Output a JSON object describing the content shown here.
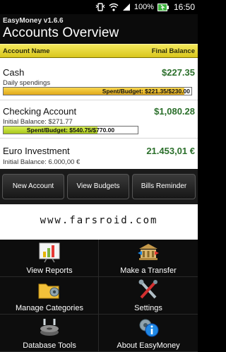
{
  "status": {
    "battery": "100%",
    "time": "16:50"
  },
  "app": {
    "version_label": "EasyMoney v1.6.6",
    "title": "Accounts Overview"
  },
  "columns": {
    "account_name": "Account Name",
    "final_balance": "Final Balance"
  },
  "accounts": [
    {
      "name": "Cash",
      "subtitle": "Daily spendings",
      "amount": "$227.35",
      "budget_label": "Spent/Budget: $221.35/$230.00",
      "budget_fraction": 0.962
    },
    {
      "name": "Checking Account",
      "subtitle": "Initial Balance: $271.77",
      "amount": "$1,080.28",
      "budget_label": "Spent/Budget: $540.75/$770.00",
      "budget_fraction": 0.702
    },
    {
      "name": "Euro Investment",
      "subtitle": "Initial Balance: 6.000,00 €",
      "amount": "21.453,01 €"
    }
  ],
  "buttons": {
    "new_account": "New Account",
    "view_budgets": "View Budgets",
    "bills_reminder": "Bills Reminder"
  },
  "watermark": "www.farsroid.com",
  "menu": [
    {
      "label": "View Reports",
      "icon": "bar-chart-icon"
    },
    {
      "label": "Make a Transfer",
      "icon": "bank-transfer-icon"
    },
    {
      "label": "Manage Categories",
      "icon": "folder-gear-icon"
    },
    {
      "label": "Settings",
      "icon": "tools-icon"
    },
    {
      "label": "Database Tools",
      "icon": "database-disk-icon"
    },
    {
      "label": "About EasyMoney",
      "icon": "info-gear-icon"
    }
  ],
  "colors": {
    "header_yellow": "#e6d83a",
    "budget_fill": "#f2c232",
    "budget_fill_2": "#c9e23a",
    "positive_green": "#2b6f2b"
  }
}
